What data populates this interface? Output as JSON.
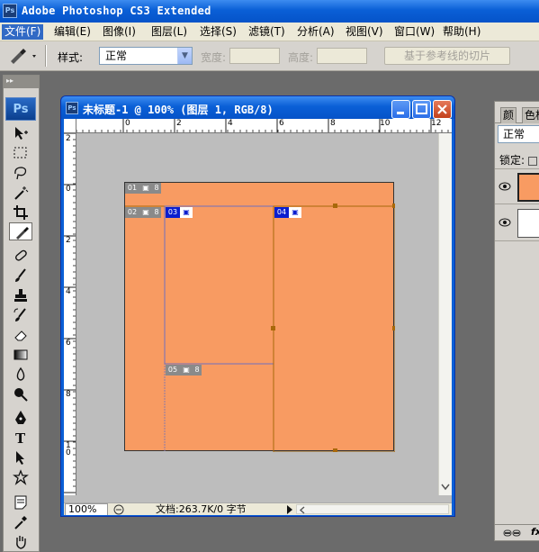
{
  "app": {
    "title": "Adobe Photoshop CS3 Extended",
    "logo": "Ps"
  },
  "menu": [
    {
      "label": "文件(F)",
      "active": true
    },
    {
      "label": "编辑(E)"
    },
    {
      "label": "图像(I)"
    },
    {
      "label": "图层(L)"
    },
    {
      "label": "选择(S)"
    },
    {
      "label": "滤镜(T)"
    },
    {
      "label": "分析(A)"
    },
    {
      "label": "视图(V)"
    },
    {
      "label": "窗口(W)"
    },
    {
      "label": "帮助(H)"
    }
  ],
  "options": {
    "style_label": "样式:",
    "style_value": "正常",
    "width_label": "宽度:",
    "height_label": "高度:",
    "slice_button": "基于参考线的切片"
  },
  "document": {
    "title": "未标题-1 @ 100% (图层 1, RGB/8)",
    "zoom": "100%",
    "doc_info": "文档:263.7K/0 字节",
    "canvas_color": "#f89b62",
    "ruler_h": [
      "0",
      "2",
      "4",
      "6",
      "8",
      "10",
      "12"
    ],
    "ruler_v": [
      "2",
      "0",
      "2",
      "4",
      "6",
      "8",
      "1 0"
    ],
    "slices": [
      {
        "id": "01",
        "kind": "auto"
      },
      {
        "id": "02",
        "kind": "auto"
      },
      {
        "id": "03",
        "kind": "user"
      },
      {
        "id": "04",
        "kind": "user"
      },
      {
        "id": "05",
        "kind": "auto"
      }
    ],
    "slice_link_label": "8"
  },
  "panel": {
    "tabs": [
      "颜",
      "色板"
    ],
    "blend_mode": "正常",
    "lock_label": "锁定:",
    "footer": "fx"
  },
  "colors": {
    "titlebar": "#0a5fd6",
    "user_slice": "#0a1ecf",
    "auto_slice": "#8a8a8a",
    "guide": "#a8680a"
  }
}
